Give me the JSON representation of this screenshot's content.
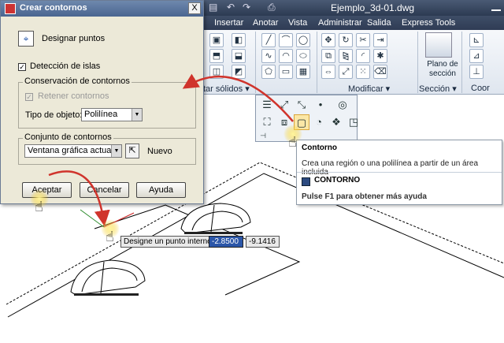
{
  "window": {
    "title": "Ejemplo_3d-01.dwg"
  },
  "menu_tabs": [
    {
      "label": "Insertar"
    },
    {
      "label": "Anotar"
    },
    {
      "label": "Vista"
    },
    {
      "label": "Administrar"
    },
    {
      "label": "Salida"
    },
    {
      "label": "Express Tools"
    }
  ],
  "ribbon": {
    "panels": [
      {
        "label": "tar sólidos ▾"
      },
      {
        "label": "Modificar ▾"
      },
      {
        "label": "Sección ▾"
      },
      {
        "label": "Coor"
      }
    ],
    "section_plane": {
      "label": "Plano de sección"
    }
  },
  "tooltip": {
    "title": "Contorno",
    "description": "Crea una región o una polilínea a partir de un área incluida",
    "command": "CONTORNO",
    "help": "Pulse F1 para obtener más ayuda"
  },
  "dialog": {
    "title": "Crear contornos",
    "close_label": "X",
    "pick_points_label": "Designar puntos",
    "island_detection": {
      "label": "Detección de islas",
      "checked": true
    },
    "retention_group": {
      "title": "Conservación de contornos",
      "retain_label": "Retener contornos",
      "retain_checked": true,
      "object_type_label": "Tipo de objeto:",
      "object_type_value": "Polilínea"
    },
    "boundary_set_group": {
      "title": "Conjunto de contornos",
      "value": "Ventana gráfica actual",
      "new_label": "Nuevo"
    },
    "buttons": {
      "accept": "Aceptar",
      "cancel": "Cancelar",
      "help": "Ayuda"
    }
  },
  "command_input": {
    "prompt": "Designe un punto interno:",
    "x_value": "-2.8500",
    "y_value": "-9.1416"
  },
  "colors": {
    "titlebar": "#2c3a52",
    "ribbon_bg": "#e4eaf2",
    "dialog_bg": "#ece9d8",
    "arrow": "#d0342c",
    "input_highlight": "#2b56a8",
    "hand_glow": "#f5c400"
  }
}
